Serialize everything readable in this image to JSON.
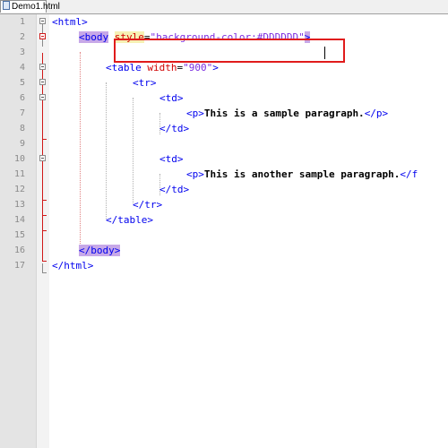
{
  "tab": {
    "title": "Demo1.html"
  },
  "lines": [
    {
      "n": "1",
      "segments": [
        {
          "cls": "tag",
          "t": "<html>"
        }
      ]
    },
    {
      "n": "2",
      "segments": [
        {
          "cls": "tag hl-bg",
          "t": "<body"
        },
        {
          "cls": "",
          "t": " "
        },
        {
          "cls": "attr hl-attr",
          "t": "style"
        },
        {
          "cls": "",
          "t": "="
        },
        {
          "cls": "val",
          "t": "\"background-color:#DDDDDD\""
        },
        {
          "cls": "tag hl-bg",
          "t": ">"
        }
      ]
    },
    {
      "n": "3",
      "segments": []
    },
    {
      "n": "4",
      "segments": [
        {
          "cls": "tag",
          "t": "<table"
        },
        {
          "cls": "",
          "t": " "
        },
        {
          "cls": "attr",
          "t": "width"
        },
        {
          "cls": "",
          "t": "="
        },
        {
          "cls": "val",
          "t": "\"900\""
        },
        {
          "cls": "tag",
          "t": ">"
        }
      ]
    },
    {
      "n": "5",
      "segments": [
        {
          "cls": "tag",
          "t": "<tr>"
        }
      ]
    },
    {
      "n": "6",
      "segments": [
        {
          "cls": "tag",
          "t": "<td>"
        }
      ]
    },
    {
      "n": "7",
      "segments": [
        {
          "cls": "tag",
          "t": "<p>"
        },
        {
          "cls": "txt",
          "t": "This is a sample paragraph."
        },
        {
          "cls": "tag",
          "t": "</p>"
        }
      ]
    },
    {
      "n": "8",
      "segments": [
        {
          "cls": "tag",
          "t": "</td>"
        }
      ]
    },
    {
      "n": "9",
      "segments": []
    },
    {
      "n": "10",
      "segments": [
        {
          "cls": "tag",
          "t": "<td>"
        }
      ]
    },
    {
      "n": "11",
      "segments": [
        {
          "cls": "tag",
          "t": "<p>"
        },
        {
          "cls": "txt",
          "t": "This is another sample paragraph."
        },
        {
          "cls": "tag",
          "t": "</f"
        }
      ]
    },
    {
      "n": "12",
      "segments": [
        {
          "cls": "tag",
          "t": "</td>"
        }
      ]
    },
    {
      "n": "13",
      "segments": [
        {
          "cls": "tag",
          "t": "</tr>"
        }
      ]
    },
    {
      "n": "14",
      "segments": [
        {
          "cls": "tag",
          "t": "</table>"
        }
      ]
    },
    {
      "n": "15",
      "segments": []
    },
    {
      "n": "16",
      "segments": [
        {
          "cls": "tag hl-bg",
          "t": "</body"
        },
        {
          "cls": "tag hl-bg",
          "t": ">"
        }
      ]
    },
    {
      "n": "17",
      "segments": [
        {
          "cls": "tag",
          "t": "</html>"
        }
      ]
    }
  ],
  "colors": {
    "tag": "#0000ee",
    "attribute": "#d00000",
    "value": "#7a2ce0",
    "highlight_box": "#e01b1b"
  }
}
